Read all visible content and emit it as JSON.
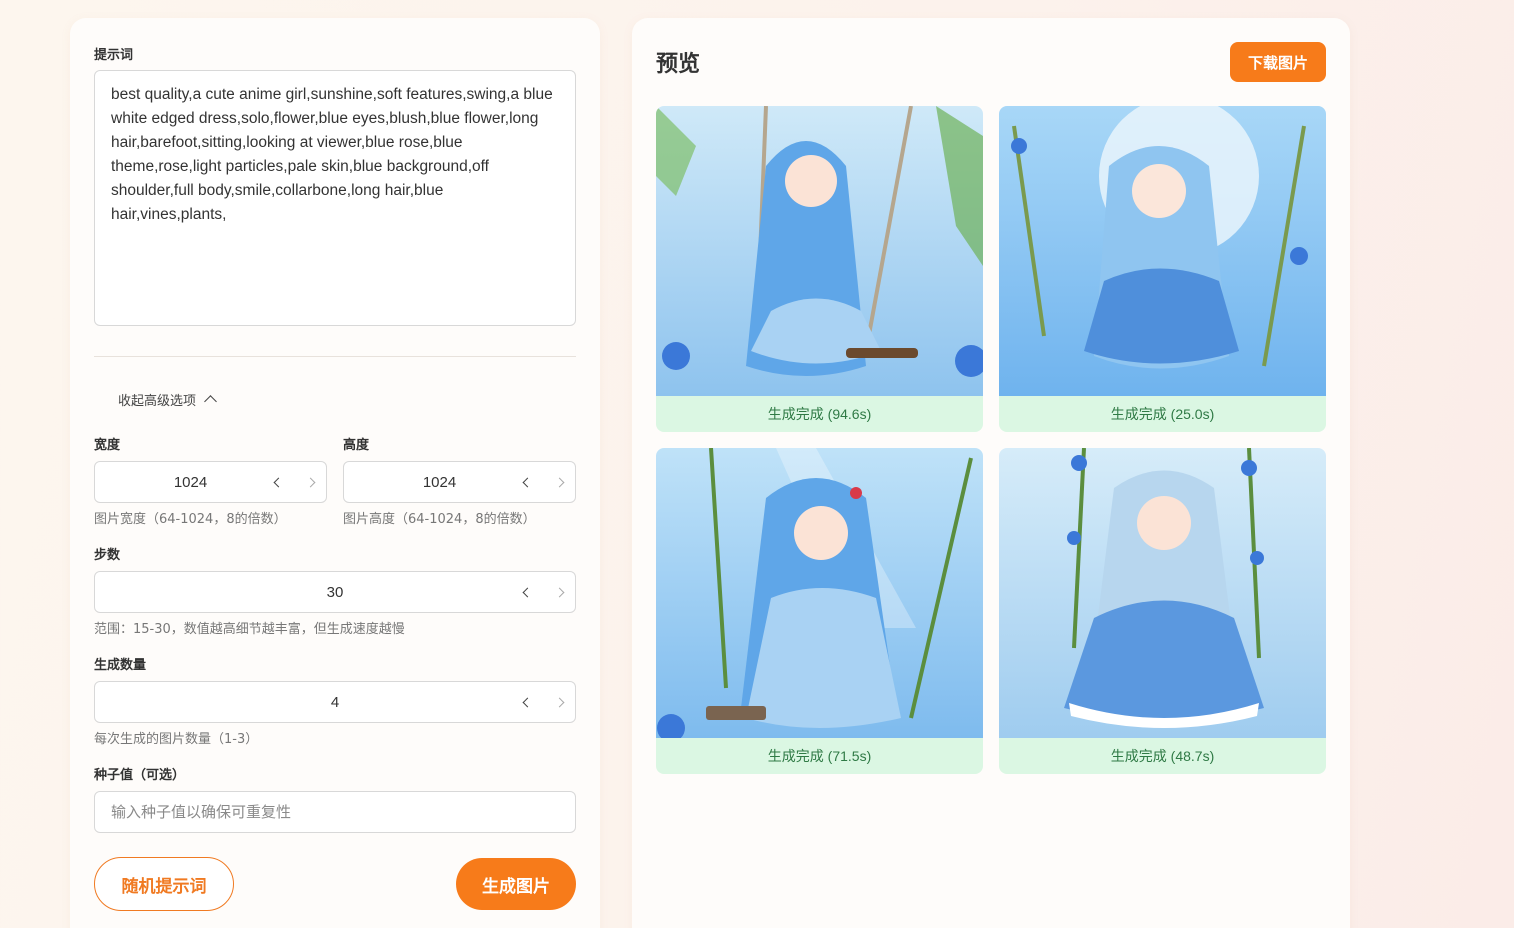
{
  "form": {
    "prompt_label": "提示词",
    "prompt_text": "best quality,a cute anime girl,sunshine,soft features,swing,a blue white edged dress,solo,flower,blue eyes,blush,blue flower,long hair,barefoot,sitting,looking at viewer,blue rose,blue theme,rose,light particles,pale skin,blue background,off shoulder,full body,smile,collarbone,long hair,blue hair,vines,plants,",
    "advanced_toggle": "收起高级选项",
    "width": {
      "label": "宽度",
      "value": "1024",
      "hint": "图片宽度（64-1024，8的倍数）"
    },
    "height": {
      "label": "高度",
      "value": "1024",
      "hint": "图片高度（64-1024，8的倍数）"
    },
    "steps": {
      "label": "步数",
      "value": "30",
      "hint": "范围：15-30，数值越高细节越丰富，但生成速度越慢"
    },
    "count": {
      "label": "生成数量",
      "value": "4",
      "hint": "每次生成的图片数量（1-3）"
    },
    "seed": {
      "label": "种子值（可选）",
      "placeholder": "输入种子值以确保可重复性",
      "value": ""
    },
    "random_button": "随机提示词",
    "generate_button": "生成图片"
  },
  "preview": {
    "title": "预览",
    "download_button": "下载图片",
    "images": [
      {
        "status": "生成完成 (94.6s)"
      },
      {
        "status": "生成完成 (25.0s)"
      },
      {
        "status": "生成完成 (71.5s)"
      },
      {
        "status": "生成完成 (48.7s)"
      }
    ]
  },
  "colors": {
    "accent": "#f77b1a",
    "status_bg": "#dbf7e3",
    "status_text": "#2f7a45"
  }
}
